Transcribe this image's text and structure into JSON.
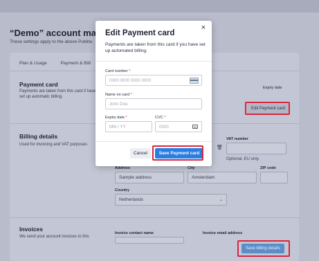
{
  "background": {
    "title": "“Demo” account mana",
    "subtitle": "These settings apply to the above Publita",
    "tabs": [
      "Plan & Usage",
      "Payment & Billi"
    ],
    "payment_card": {
      "heading": "Payment card",
      "desc": "Payments are taken from this card if have set up automatic billing.",
      "expiry_label": "Expiry date",
      "edit_button": "Edit Payment card"
    },
    "billing": {
      "heading": "Billing details",
      "desc": "Used for invoicing and VAT purposes",
      "vat_label": "VAT number",
      "vat_hint": "Optional, EU only.",
      "address_label": "Address",
      "address_value": "Sample address",
      "city_label": "City",
      "city_value": "Amsterdam",
      "zip_label": "ZIP code",
      "country_label": "Country",
      "country_value": "Netherlands"
    },
    "invoices": {
      "heading": "Invoices",
      "desc": "We send your account invoices to this",
      "contact_label": "Invoice contact name",
      "email_label": "Invoice email address",
      "save_button": "Save billing details"
    }
  },
  "modal": {
    "close_symbol": "×",
    "title": "Edit Payment card",
    "description": "Payments are taken from this card if you have set up automated billing.",
    "card_number": {
      "label": "Card number",
      "placeholder": "0000 0000 0000 0000"
    },
    "name_on_card": {
      "label": "Name on card",
      "placeholder": "John Doe"
    },
    "expiry": {
      "label": "Expiry date",
      "placeholder": "MM / YY"
    },
    "cvc": {
      "label": "CVC",
      "placeholder": "0000"
    },
    "required_mark": "*",
    "cancel_label": "Cancel",
    "save_label": "Save Payment card"
  },
  "colors": {
    "accent": "#2a7de1",
    "highlight": "#d9253b",
    "overlay": "#8a8fa1"
  }
}
